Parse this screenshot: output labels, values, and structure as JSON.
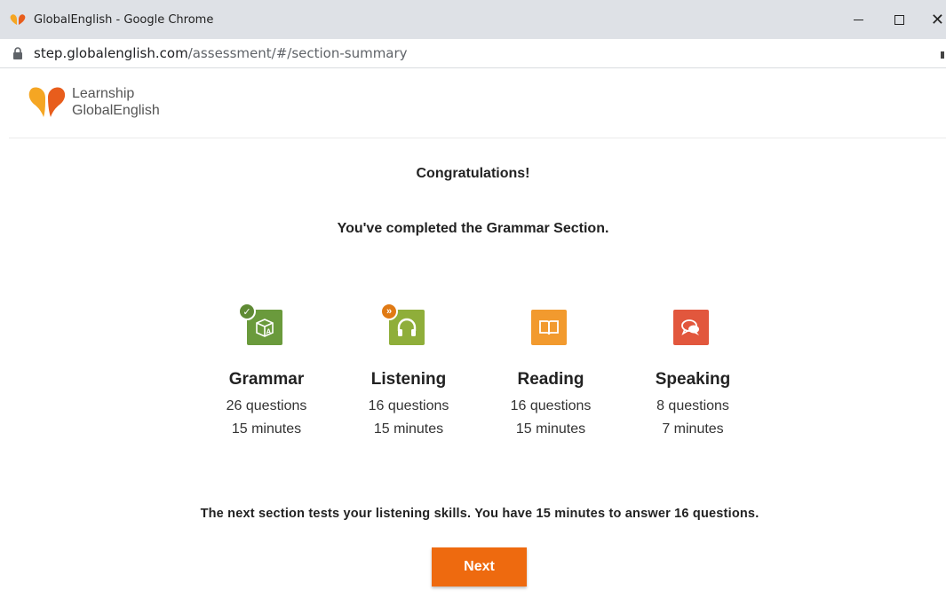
{
  "browser": {
    "window_title": "GlobalEnglish - Google Chrome",
    "url_host": "step.globalenglish.com",
    "url_path": "/assessment/#/section-summary"
  },
  "logo": {
    "line1": "Learnship",
    "line2": "GlobalEnglish"
  },
  "main": {
    "congrats": "Congratulations!",
    "completed": "You've completed the Grammar Section.",
    "next_info": "The next section tests your listening skills. You have 15 minutes to answer 16 questions.",
    "next_label": "Next"
  },
  "sections": [
    {
      "name": "Grammar",
      "questions": "26 questions",
      "minutes": "15 minutes",
      "icon": "block-a-icon",
      "color": "#6a9a3c",
      "status": "completed"
    },
    {
      "name": "Listening",
      "questions": "16 questions",
      "minutes": "15 minutes",
      "icon": "headphones-icon",
      "color": "#8fae3a",
      "status": "next"
    },
    {
      "name": "Reading",
      "questions": "16 questions",
      "minutes": "15 minutes",
      "icon": "book-icon",
      "color": "#f29a2e",
      "status": "pending"
    },
    {
      "name": "Speaking",
      "questions": "8 questions",
      "minutes": "7 minutes",
      "icon": "speech-bubble-icon",
      "color": "#e2573d",
      "status": "pending"
    }
  ],
  "colors": {
    "accent": "#ee6a0f",
    "completed_badge": "#5f8a34",
    "next_badge": "#e07a14"
  }
}
